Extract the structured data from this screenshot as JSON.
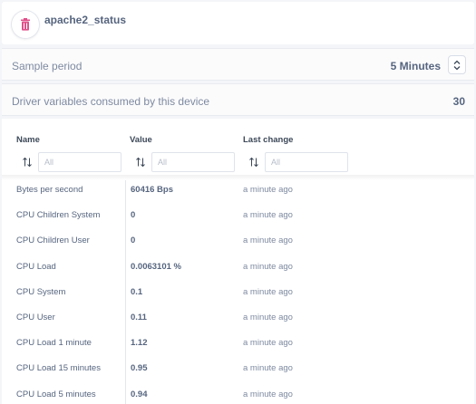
{
  "header": {
    "title": "apache2_status",
    "icon": "trash-icon",
    "icon_color": "#e0508a"
  },
  "sample_period": {
    "label": "Sample period",
    "value": "5 Minutes"
  },
  "driver_vars": {
    "label": "Driver variables consumed by this device",
    "count": "30"
  },
  "table": {
    "columns": [
      {
        "label": "Name",
        "placeholder": "All"
      },
      {
        "label": "Value",
        "placeholder": "All"
      },
      {
        "label": "Last change",
        "placeholder": "All"
      }
    ],
    "rows": [
      {
        "name": "Bytes per second",
        "value": "60416 Bps",
        "last_change": "a minute ago"
      },
      {
        "name": "CPU Children System",
        "value": "0",
        "last_change": "a minute ago"
      },
      {
        "name": "CPU Children User",
        "value": "0",
        "last_change": "a minute ago"
      },
      {
        "name": "CPU Load",
        "value": "0.0063101 %",
        "last_change": "a minute ago"
      },
      {
        "name": "CPU System",
        "value": "0.1",
        "last_change": "a minute ago"
      },
      {
        "name": "CPU User",
        "value": "0.11",
        "last_change": "a minute ago"
      },
      {
        "name": "CPU Load 1 minute",
        "value": "1.12",
        "last_change": "a minute ago"
      },
      {
        "name": "CPU Load 15 minutes",
        "value": "0.95",
        "last_change": "a minute ago"
      },
      {
        "name": "CPU Load 5 minutes",
        "value": "0.94",
        "last_change": "a minute ago"
      }
    ]
  }
}
